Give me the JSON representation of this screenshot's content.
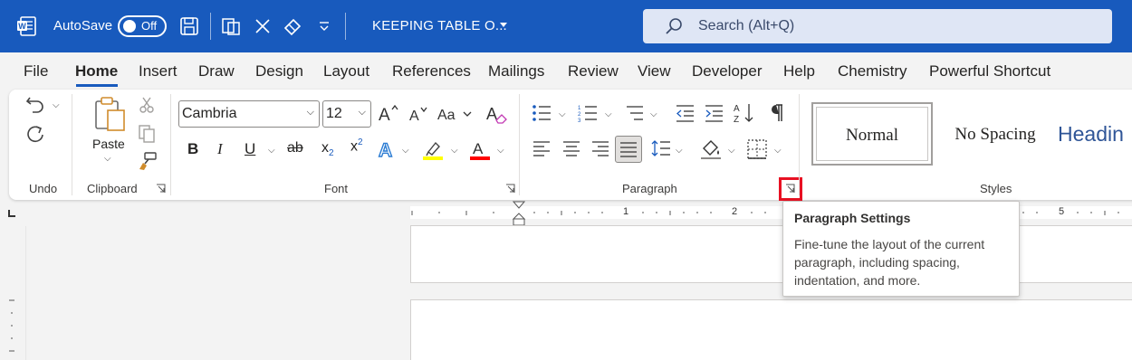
{
  "titlebar": {
    "autosave_label": "AutoSave",
    "autosave_state": "Off",
    "document_title": "KEEPING TABLE O...",
    "search_placeholder": "Search (Alt+Q)"
  },
  "tabs": [
    {
      "label": "File"
    },
    {
      "label": "Home",
      "active": true
    },
    {
      "label": "Insert"
    },
    {
      "label": "Draw"
    },
    {
      "label": "Design"
    },
    {
      "label": "Layout"
    },
    {
      "label": "References"
    },
    {
      "label": "Mailings"
    },
    {
      "label": "Review"
    },
    {
      "label": "View"
    },
    {
      "label": "Developer"
    },
    {
      "label": "Help"
    },
    {
      "label": "Chemistry"
    },
    {
      "label": "Powerful Shortcut"
    }
  ],
  "ribbon": {
    "groups": {
      "undo": "Undo",
      "clipboard": "Clipboard",
      "font": "Font",
      "paragraph": "Paragraph",
      "styles": "Styles"
    },
    "clipboard": {
      "paste_label": "Paste"
    },
    "font": {
      "family": "Cambria",
      "size": "12"
    },
    "styles": [
      {
        "label": "Normal"
      },
      {
        "label": "No Spacing"
      },
      {
        "label": "Headin"
      }
    ]
  },
  "ruler": {
    "numbers": [
      "1",
      "2",
      "5"
    ]
  },
  "tooltip": {
    "title": "Paragraph Settings",
    "body": "Fine-tune the layout of the current paragraph, including spacing, indentation, and more."
  },
  "colors": {
    "brand": "#185abd",
    "highlight_marker": "#e81123",
    "highlighter_yellow": "#ffff00",
    "font_color_red": "#ff0000"
  }
}
